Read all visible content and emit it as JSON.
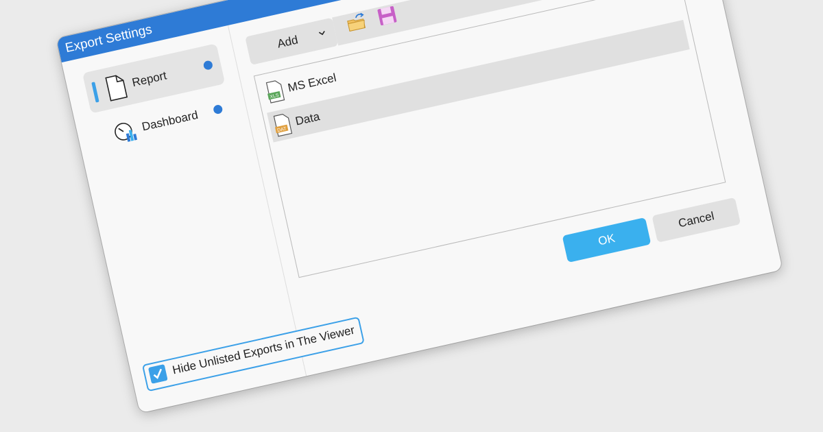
{
  "dialog": {
    "title": "Export Settings",
    "nav": [
      {
        "label": "Report",
        "icon": "document-icon",
        "active": true,
        "status_color": "#2e7bd6"
      },
      {
        "label": "Dashboard",
        "icon": "dashboard-icon",
        "active": false,
        "status_color": "#2e7bd6"
      }
    ],
    "toolbar": {
      "add_label": "Add",
      "open_icon": "open-folder-icon",
      "save_icon": "save-icon"
    },
    "exports": [
      {
        "label": "MS Excel",
        "icon": "xls-file-icon",
        "badge": "XLS",
        "selected": false
      },
      {
        "label": "Data",
        "icon": "dat-file-icon",
        "badge": "DAT",
        "selected": true
      }
    ],
    "ok_label": "OK",
    "cancel_label": "Cancel",
    "hide_unlisted_label": "Hide Unlisted Exports in The Viewer",
    "hide_unlisted_checked": true
  },
  "colors": {
    "titlebar": "#2e7bd6",
    "accent": "#3ab0ee",
    "background": "#ebebeb"
  }
}
